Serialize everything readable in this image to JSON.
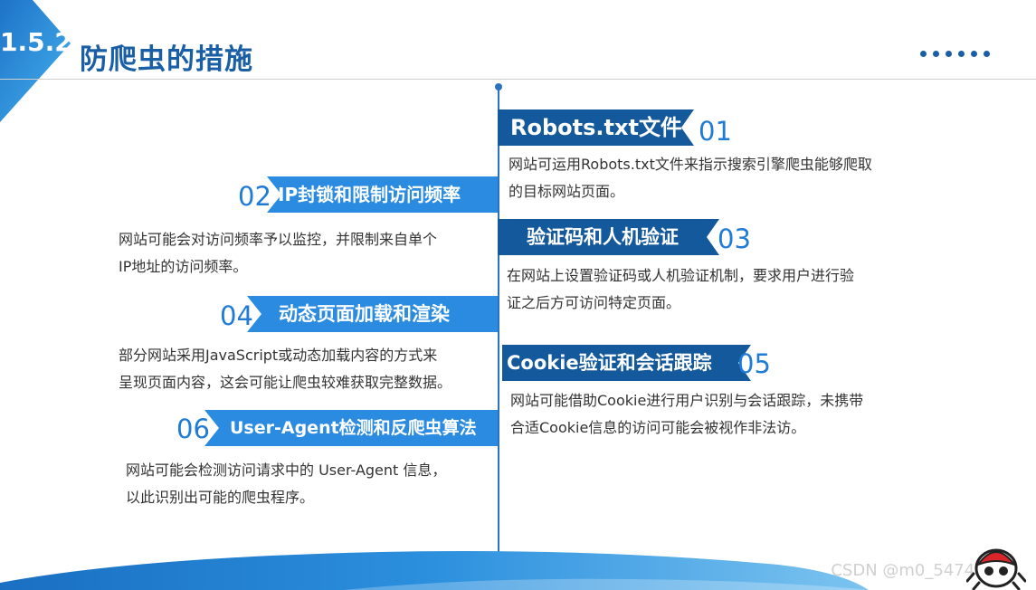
{
  "header": {
    "section_number": "1.5.2",
    "title": "防爬虫的措施"
  },
  "items": [
    {
      "number": "01",
      "title": "Robots.txt文件",
      "lines": [
        "网站可运用Robots.txt文件来指示搜索引擎爬虫能够爬取",
        "的目标网站页面。"
      ]
    },
    {
      "number": "02",
      "title": "IP封锁和限制访问频率",
      "lines": [
        "网站可能会对访问频率予以监控，并限制来自单个",
        "IP地址的访问频率。"
      ]
    },
    {
      "number": "03",
      "title": "验证码和人机验证",
      "lines": [
        "在网站上设置验证码或人机验证机制，要求用户进行验",
        "证之后方可访问特定页面。"
      ]
    },
    {
      "number": "04",
      "title": "动态页面加载和渲染",
      "lines": [
        "部分网站采用JavaScript或动态加载内容的方式来",
        "呈现页面内容，这会可能让爬虫较难获取完整数据。"
      ]
    },
    {
      "number": "05",
      "title": "Cookie验证和会话跟踪",
      "lines": [
        "网站可能借助Cookie进行用户识别与会话跟踪，未携带",
        "合适Cookie信息的访问可能会被视作非法访。"
      ]
    },
    {
      "number": "06",
      "title": "User-Agent检测和反爬虫算法",
      "lines": [
        "网站可能会检测访问请求中的 User-Agent 信息，",
        "以此识别出可能的爬虫程序。"
      ]
    }
  ],
  "watermark": "CSDN @m0_54743666",
  "colors": {
    "dark_blue": "#14599b",
    "light_blue": "#2a8be0",
    "title_blue": "#1a5fa6"
  },
  "icons": [
    "section-corner-shape",
    "header-dots",
    "wave-decoration",
    "mascot-icon"
  ]
}
